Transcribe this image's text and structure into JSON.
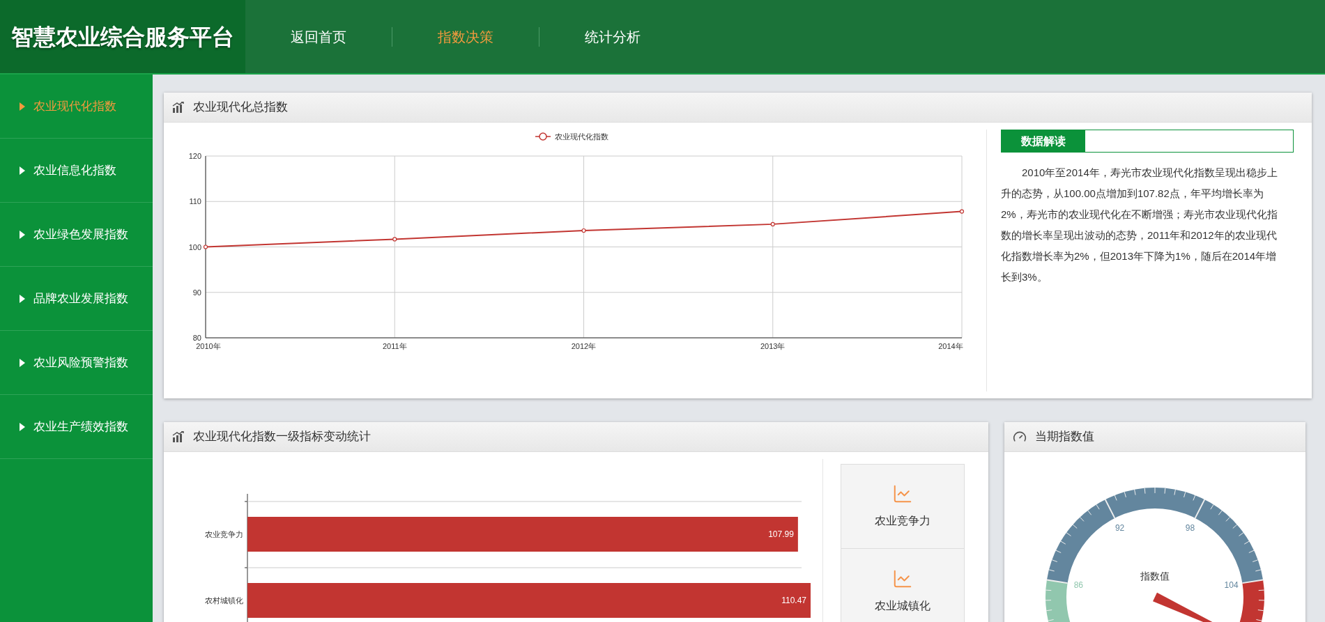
{
  "header": {
    "logo": "智慧农业综合服务平台",
    "nav": [
      {
        "label": "返回首页",
        "selected": false
      },
      {
        "label": "指数决策",
        "selected": true
      },
      {
        "label": "统计分析",
        "selected": false
      }
    ]
  },
  "sidebar": {
    "items": [
      {
        "label": "农业现代化指数",
        "selected": true
      },
      {
        "label": "农业信息化指数",
        "selected": false
      },
      {
        "label": "农业绿色发展指数",
        "selected": false
      },
      {
        "label": "品牌农业发展指数",
        "selected": false
      },
      {
        "label": "农业风险预警指数",
        "selected": false
      },
      {
        "label": "农业生产绩效指数",
        "selected": false
      }
    ]
  },
  "overview_panel": {
    "title": "农业现代化总指数",
    "chart_data": {
      "type": "line",
      "categories": [
        "2010年",
        "2011年",
        "2012年",
        "2013年",
        "2014年"
      ],
      "series": [
        {
          "name": "农业现代化指数",
          "color": "#c23531",
          "values": [
            100,
            101.7,
            103.6,
            105.0,
            107.8
          ]
        }
      ],
      "grid": true,
      "marker": true,
      "ylim": [
        80,
        120
      ],
      "yticks": [
        80,
        90,
        100,
        110,
        120
      ]
    },
    "interpretation": {
      "title": "数据解读",
      "text": "2010年至2014年，寿光市农业现代化指数呈现出稳步上升的态势，从100.00点增加到107.82点，年平均增长率为2%，寿光市的农业现代化在不断增强；寿光市农业现代化指数的增长率呈现出波动的态势，2011年和2012年的农业现代化指数增长率为2%，但2013年下降为1%，随后在2014年增长到3%。"
    }
  },
  "indicator_panel": {
    "title": "农业现代化指数一级指标变动统计",
    "chart_data": {
      "type": "bar",
      "orientation": "horizontal",
      "categories": [
        "农业竞争力",
        "农村城镇化"
      ],
      "values": [
        107.99,
        110.47
      ],
      "data_labels": true
    },
    "buttons": [
      "农业竞争力",
      "农业城镇化"
    ]
  },
  "gauge_panel": {
    "title": "当期指数值",
    "gauge": {
      "label": "指数值",
      "ticks": [
        "86",
        "92",
        "98",
        "104"
      ]
    }
  }
}
